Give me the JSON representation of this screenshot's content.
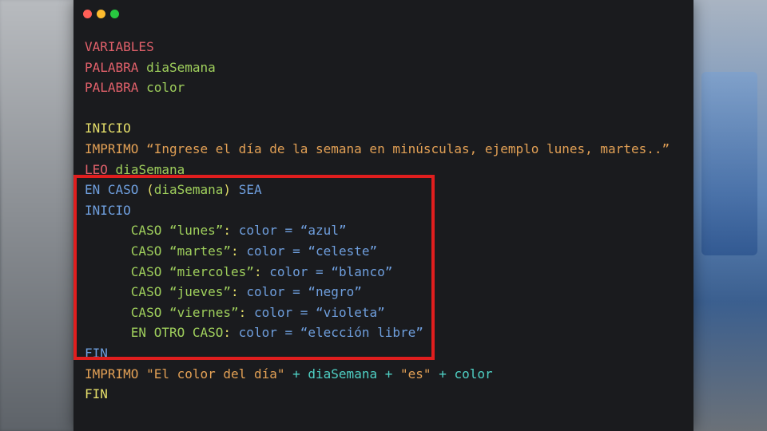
{
  "window": {
    "buttons": {
      "close": "close",
      "minimize": "minimize",
      "zoom": "zoom"
    }
  },
  "code": {
    "variables": "VARIABLES",
    "kw_palabra": "PALABRA",
    "var_diaSemana": "diaSemana",
    "var_color": "color",
    "inicio": "INICIO",
    "imprimo": "IMPRIMO",
    "prompt_string": "“Ingrese el día de la semana en minúsculas, ejemplo lunes, martes..”",
    "leo": "LEO",
    "en_caso": "EN CASO",
    "paren_open": "(",
    "paren_close": ")",
    "sea": "SEA",
    "caso": "CASO",
    "colon": ":",
    "equals": "=",
    "cases": [
      {
        "day": "“lunes”",
        "value": "“azul”"
      },
      {
        "day": "“martes”",
        "value": "“celeste”"
      },
      {
        "day": "“miercoles”",
        "value": "“blanco”"
      },
      {
        "day": "“jueves”",
        "value": "“negro”"
      },
      {
        "day": "“viernes”",
        "value": "“violeta”"
      }
    ],
    "en_otro_caso": "EN OTRO CASO",
    "default_value": "“elección libre”",
    "fin": "FIN",
    "print_string1": "\"El color del día\"",
    "plus": "+",
    "print_string2": "\"es\""
  },
  "colors": {
    "keyword_red": "#e0606a",
    "identifier_green": "#9fcf5c",
    "block_yellow": "#e6df6a",
    "string_orange": "#e2a055",
    "switch_blue": "#6f9fde",
    "var_teal": "#4fd1c5",
    "highlight_box": "#e01e1e"
  }
}
